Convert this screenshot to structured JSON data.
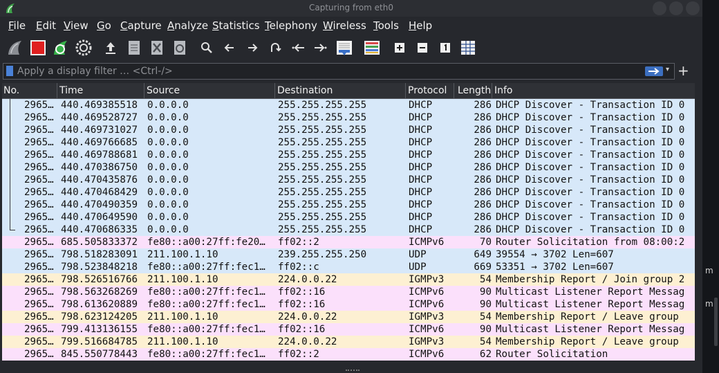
{
  "window": {
    "title": "Capturing from eth0"
  },
  "menu": [
    "File",
    "Edit",
    "View",
    "Go",
    "Capture",
    "Analyze",
    "Statistics",
    "Telephony",
    "Wireless",
    "Tools",
    "Help"
  ],
  "toolbar": {
    "icons": [
      "shark-fin-start-icon",
      "stop-capture-icon",
      "restart-capture-icon",
      "capture-options-icon",
      "open-file-icon",
      "save-file-icon",
      "close-file-icon",
      "reload-file-icon",
      "find-packet-icon",
      "go-back-icon",
      "go-forward-icon",
      "go-to-packet-icon",
      "first-packet-icon",
      "last-packet-icon",
      "auto-scroll-icon",
      "colorize-icon",
      "zoom-in-icon",
      "zoom-out-icon",
      "normal-size-icon",
      "resize-columns-icon"
    ]
  },
  "filter": {
    "placeholder": "Apply a display filter … <Ctrl-/>",
    "value": ""
  },
  "columns": {
    "no": "No.",
    "time": "Time",
    "source": "Source",
    "destination": "Destination",
    "protocol": "Protocol",
    "length": "Length",
    "info": "Info"
  },
  "colors": {
    "udp_row": "#d7e8f9",
    "icmpv6_row": "#fbe0fb",
    "igmp_row": "#fdf0d2"
  },
  "packets": [
    {
      "no": "2965…",
      "time": "440.469385518",
      "source": "0.0.0.0",
      "destination": "255.255.255.255",
      "protocol": "DHCP",
      "length": "286",
      "info": "DHCP Discover - Transaction ID 0",
      "color": "udp_row",
      "tree": "line"
    },
    {
      "no": "2965…",
      "time": "440.469528727",
      "source": "0.0.0.0",
      "destination": "255.255.255.255",
      "protocol": "DHCP",
      "length": "286",
      "info": "DHCP Discover - Transaction ID 0",
      "color": "udp_row",
      "tree": "line"
    },
    {
      "no": "2965…",
      "time": "440.469731027",
      "source": "0.0.0.0",
      "destination": "255.255.255.255",
      "protocol": "DHCP",
      "length": "286",
      "info": "DHCP Discover - Transaction ID 0",
      "color": "udp_row",
      "tree": "line"
    },
    {
      "no": "2965…",
      "time": "440.469766685",
      "source": "0.0.0.0",
      "destination": "255.255.255.255",
      "protocol": "DHCP",
      "length": "286",
      "info": "DHCP Discover - Transaction ID 0",
      "color": "udp_row",
      "tree": "line"
    },
    {
      "no": "2965…",
      "time": "440.469788681",
      "source": "0.0.0.0",
      "destination": "255.255.255.255",
      "protocol": "DHCP",
      "length": "286",
      "info": "DHCP Discover - Transaction ID 0",
      "color": "udp_row",
      "tree": "line"
    },
    {
      "no": "2965…",
      "time": "440.470386750",
      "source": "0.0.0.0",
      "destination": "255.255.255.255",
      "protocol": "DHCP",
      "length": "286",
      "info": "DHCP Discover - Transaction ID 0",
      "color": "udp_row",
      "tree": "line"
    },
    {
      "no": "2965…",
      "time": "440.470435876",
      "source": "0.0.0.0",
      "destination": "255.255.255.255",
      "protocol": "DHCP",
      "length": "286",
      "info": "DHCP Discover - Transaction ID 0",
      "color": "udp_row",
      "tree": "line"
    },
    {
      "no": "2965…",
      "time": "440.470468429",
      "source": "0.0.0.0",
      "destination": "255.255.255.255",
      "protocol": "DHCP",
      "length": "286",
      "info": "DHCP Discover - Transaction ID 0",
      "color": "udp_row",
      "tree": "line"
    },
    {
      "no": "2965…",
      "time": "440.470490359",
      "source": "0.0.0.0",
      "destination": "255.255.255.255",
      "protocol": "DHCP",
      "length": "286",
      "info": "DHCP Discover - Transaction ID 0",
      "color": "udp_row",
      "tree": "line"
    },
    {
      "no": "2965…",
      "time": "440.470649590",
      "source": "0.0.0.0",
      "destination": "255.255.255.255",
      "protocol": "DHCP",
      "length": "286",
      "info": "DHCP Discover - Transaction ID 0",
      "color": "udp_row",
      "tree": "line"
    },
    {
      "no": "2965…",
      "time": "440.470686335",
      "source": "0.0.0.0",
      "destination": "255.255.255.255",
      "protocol": "DHCP",
      "length": "286",
      "info": "DHCP Discover - Transaction ID 0",
      "color": "udp_row",
      "tree": "end"
    },
    {
      "no": "2965…",
      "time": "685.505833372",
      "source": "fe80::a00:27ff:fe20…",
      "destination": "ff02::2",
      "protocol": "ICMPv6",
      "length": "70",
      "info": "Router Solicitation from 08:00:2",
      "color": "icmpv6_row",
      "tree": "none"
    },
    {
      "no": "2965…",
      "time": "798.518283091",
      "source": "211.100.1.10",
      "destination": "239.255.255.250",
      "protocol": "UDP",
      "length": "649",
      "info": "39554 → 3702 Len=607",
      "color": "udp_row",
      "tree": "none"
    },
    {
      "no": "2965…",
      "time": "798.523848218",
      "source": "fe80::a00:27ff:fec1…",
      "destination": "ff02::c",
      "protocol": "UDP",
      "length": "669",
      "info": "53351 → 3702 Len=607",
      "color": "udp_row",
      "tree": "none"
    },
    {
      "no": "2965…",
      "time": "798.526516766",
      "source": "211.100.1.10",
      "destination": "224.0.0.22",
      "protocol": "IGMPv3",
      "length": "54",
      "info": "Membership Report / Join group 2",
      "color": "igmp_row",
      "tree": "none"
    },
    {
      "no": "2965…",
      "time": "798.563268269",
      "source": "fe80::a00:27ff:fec1…",
      "destination": "ff02::16",
      "protocol": "ICMPv6",
      "length": "90",
      "info": "Multicast Listener Report Messag",
      "color": "icmpv6_row",
      "tree": "none"
    },
    {
      "no": "2965…",
      "time": "798.613620889",
      "source": "fe80::a00:27ff:fec1…",
      "destination": "ff02::16",
      "protocol": "ICMPv6",
      "length": "90",
      "info": "Multicast Listener Report Messag",
      "color": "icmpv6_row",
      "tree": "none"
    },
    {
      "no": "2965…",
      "time": "798.623124205",
      "source": "211.100.1.10",
      "destination": "224.0.0.22",
      "protocol": "IGMPv3",
      "length": "54",
      "info": "Membership Report / Leave group",
      "color": "igmp_row",
      "tree": "none"
    },
    {
      "no": "2965…",
      "time": "799.413136155",
      "source": "fe80::a00:27ff:fec1…",
      "destination": "ff02::16",
      "protocol": "ICMPv6",
      "length": "90",
      "info": "Multicast Listener Report Messag",
      "color": "icmpv6_row",
      "tree": "none"
    },
    {
      "no": "2965…",
      "time": "799.516684785",
      "source": "211.100.1.10",
      "destination": "224.0.0.22",
      "protocol": "IGMPv3",
      "length": "54",
      "info": "Membership Report / Leave group",
      "color": "igmp_row",
      "tree": "none"
    },
    {
      "no": "2965…",
      "time": "845.550778443",
      "source": "fe80::a00:27ff:fec1…",
      "destination": "ff02::2",
      "protocol": "ICMPv6",
      "length": "62",
      "info": "Router Solicitation",
      "color": "icmpv6_row",
      "tree": "none"
    }
  ],
  "side_panel": {
    "glyph_1": "m",
    "glyph_2": "m"
  }
}
